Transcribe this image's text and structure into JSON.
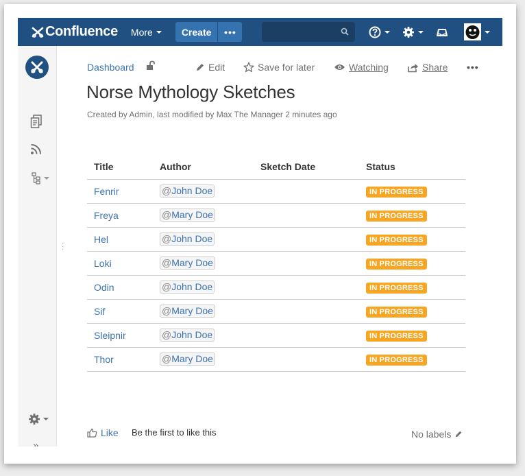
{
  "header": {
    "app_name": "Confluence",
    "more_label": "More",
    "create_label": "Create",
    "create_more_label": "•••",
    "search_placeholder": "",
    "icons": [
      "help-icon",
      "settings-icon",
      "notifications-icon",
      "avatar"
    ],
    "colors": {
      "bar": "#205081",
      "button": "#3572b0",
      "search": "#1b3e63"
    }
  },
  "sidebar": {
    "icons": [
      "space-logo",
      "pages-icon",
      "blog-feed-icon",
      "page-tree-icon",
      "space-tools-icon",
      "expand-icon"
    ],
    "expand_label": "»"
  },
  "page": {
    "breadcrumb": "Dashboard",
    "actions": {
      "edit": "Edit",
      "save_for_later": "Save for later",
      "watching": "Watching",
      "share": "Share",
      "more": "•••"
    },
    "title": "Norse Mythology Sketches",
    "byline": "Created by Admin, last modified by Max The Manager 2 minutes ago"
  },
  "table": {
    "columns": [
      "Title",
      "Author",
      "Sketch Date",
      "Status"
    ],
    "rows": [
      {
        "title": "Fenrir",
        "author": "John Doe",
        "date": "",
        "status": "IN PROGRESS"
      },
      {
        "title": "Freya",
        "author": "Mary Doe",
        "date": "",
        "status": "IN PROGRESS"
      },
      {
        "title": "Hel",
        "author": "John Doe",
        "date": "",
        "status": "IN PROGRESS"
      },
      {
        "title": "Loki",
        "author": "Mary Doe",
        "date": "",
        "status": "IN PROGRESS"
      },
      {
        "title": "Odin",
        "author": "John Doe",
        "date": "",
        "status": "IN PROGRESS"
      },
      {
        "title": "Sif",
        "author": "Mary Doe",
        "date": "",
        "status": "IN PROGRESS"
      },
      {
        "title": "Sleipnir",
        "author": "John Doe",
        "date": "",
        "status": "IN PROGRESS"
      },
      {
        "title": "Thor",
        "author": "Mary Doe",
        "date": "",
        "status": "IN PROGRESS"
      }
    ],
    "mention_prefix": "@",
    "status_color": "#f6a623"
  },
  "footer": {
    "like_label": "Like",
    "like_note": "Be the first to like this",
    "labels_text": "No labels"
  }
}
